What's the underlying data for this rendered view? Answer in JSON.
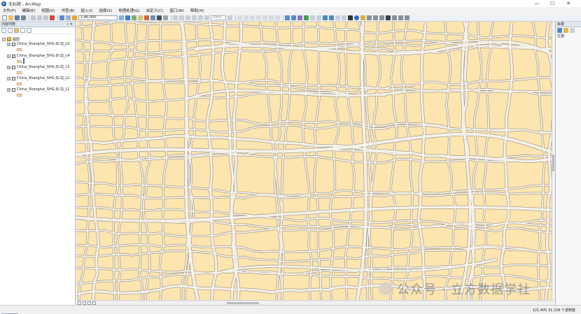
{
  "window": {
    "title": "无标题 - ArcMap",
    "minimize": "—",
    "maximize": "☐",
    "close": "✕"
  },
  "menu": [
    "文件(F)",
    "编辑(E)",
    "视图(V)",
    "书签(B)",
    "插入(I)",
    "选择(S)",
    "地理处理(G)",
    "自定义(C)",
    "窗口(W)",
    "帮助(H)"
  ],
  "toolbar": {
    "scale": "1:40,000",
    "zoom_box": "100%",
    "editor_box": ""
  },
  "toc": {
    "title": "内容列表",
    "pin": "ᚼ ✕",
    "root_label": "图层",
    "layers": [
      {
        "label": "China_Shanghai_SHG-JS-ZJ_L5",
        "checked": false
      },
      {
        "label": "China_Shanghai_SHG-JS-ZJ_L4",
        "checked": true
      },
      {
        "label": "China_Shanghai_SHG-JS-ZJ_L3",
        "checked": false
      },
      {
        "label": "China_Shanghai_SHG-JS-ZJ_L2",
        "checked": false
      },
      {
        "label": "China_Shanghai_SHG-JS-ZJ_L1",
        "checked": false
      }
    ],
    "tab_label": "内容列表"
  },
  "right_panel": {
    "title": "目录",
    "location_label": "位置:"
  },
  "status": {
    "coordinates": "121.405  31.228 十进制度"
  },
  "watermark": {
    "text": "公众号 · 立方数据学社"
  },
  "colors": {
    "land": "#fde5b0",
    "road_casing": "#9b9381",
    "road_fill": "#f4f1ea"
  }
}
